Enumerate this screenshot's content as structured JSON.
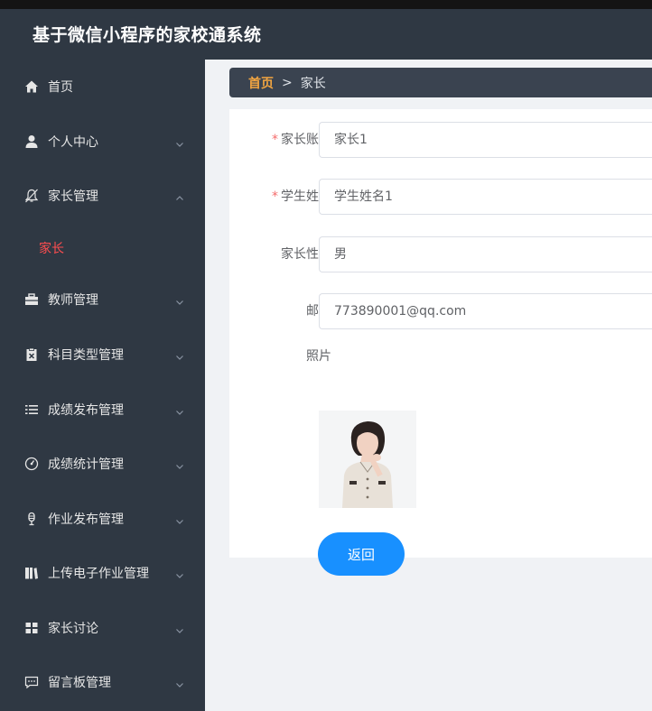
{
  "app": {
    "title": "基于微信小程序的家校通系统"
  },
  "sidebar": {
    "items": [
      {
        "label": "首页",
        "icon": "home-icon"
      },
      {
        "label": "个人中心",
        "icon": "user-icon"
      },
      {
        "label": "家长管理",
        "icon": "bell-off-icon",
        "expanded": true,
        "children": [
          {
            "label": "家长",
            "active": true
          }
        ]
      },
      {
        "label": "教师管理",
        "icon": "briefcase-icon"
      },
      {
        "label": "科目类型管理",
        "icon": "clipboard-icon"
      },
      {
        "label": "成绩发布管理",
        "icon": "list-icon"
      },
      {
        "label": "成绩统计管理",
        "icon": "gauge-icon"
      },
      {
        "label": "作业发布管理",
        "icon": "microphone-icon"
      },
      {
        "label": "上传电子作业管理",
        "icon": "books-icon"
      },
      {
        "label": "家长讨论",
        "icon": "grid-icon"
      },
      {
        "label": "留言板管理",
        "icon": "chat-icon"
      }
    ]
  },
  "breadcrumb": {
    "home": "首页",
    "separator": ">",
    "current": "家长"
  },
  "form": {
    "account": {
      "label": "家长账号",
      "value": "家长1",
      "required": true
    },
    "student_name": {
      "label": "学生姓名",
      "value": "学生姓名1",
      "required": true
    },
    "gender": {
      "label": "家长性别",
      "value": "男"
    },
    "email": {
      "label": "邮箱",
      "value": "773890001@qq.com"
    },
    "photo": {
      "label": "照片"
    },
    "back_label": "返回"
  },
  "colors": {
    "sidebar_bg": "#2f3843",
    "accent": "#1890ff",
    "active_menu": "#ff4d4f",
    "breadcrumb_home": "#f2a541",
    "required": "#f56c6c"
  }
}
